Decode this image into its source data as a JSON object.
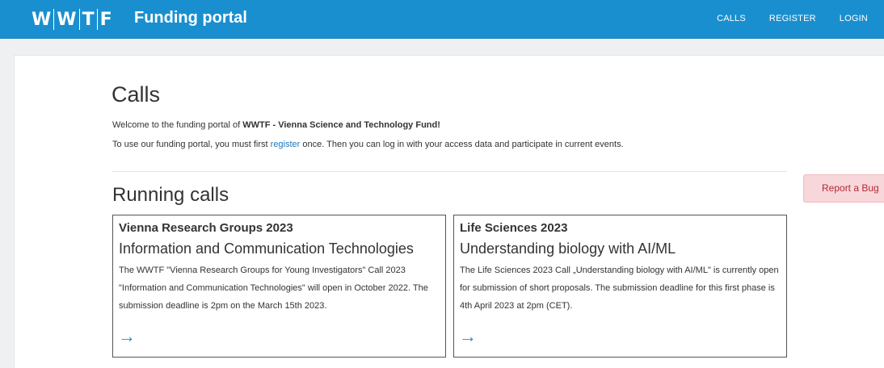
{
  "header": {
    "logo_letters": [
      "W",
      "W",
      "T",
      "F"
    ],
    "title": "Funding portal",
    "nav": [
      "CALLS",
      "REGISTER",
      "LOGIN"
    ]
  },
  "main": {
    "title": "Calls",
    "welcome_prefix": "Welcome to the funding portal of ",
    "welcome_org": "WWTF - Vienna Science and Technology Fund!",
    "instructions_prefix": "To use our funding portal, you must first ",
    "instructions_link": "register",
    "instructions_suffix": " once. Then you can log in with your access data and participate in current events.",
    "section_title": "Running calls",
    "bug_button": "Report a Bug",
    "calls": [
      {
        "title": "Vienna Research Groups 2023",
        "subtitle": "Information and Communication Technologies",
        "description": "The WWTF \"Vienna Research Groups for Young Investigators\" Call 2023 \"Information and Communication Technologies\" will open in October 2022. The submission deadline is 2pm on the March 15th 2023.",
        "arrow": "→"
      },
      {
        "title": "Life Sciences 2023",
        "subtitle": "Understanding biology with AI/ML",
        "description": "The Life Sciences 2023 Call „Understanding biology with AI/ML\" is currently open for submission of short proposals. The submission deadline for this first phase is 4th April 2023 at 2pm (CET).",
        "arrow": "→"
      }
    ]
  },
  "colors": {
    "header_bg": "#1a8fcf",
    "link": "#1a7abf",
    "bug_bg": "#f8d7da",
    "bug_text": "#b02a37"
  }
}
